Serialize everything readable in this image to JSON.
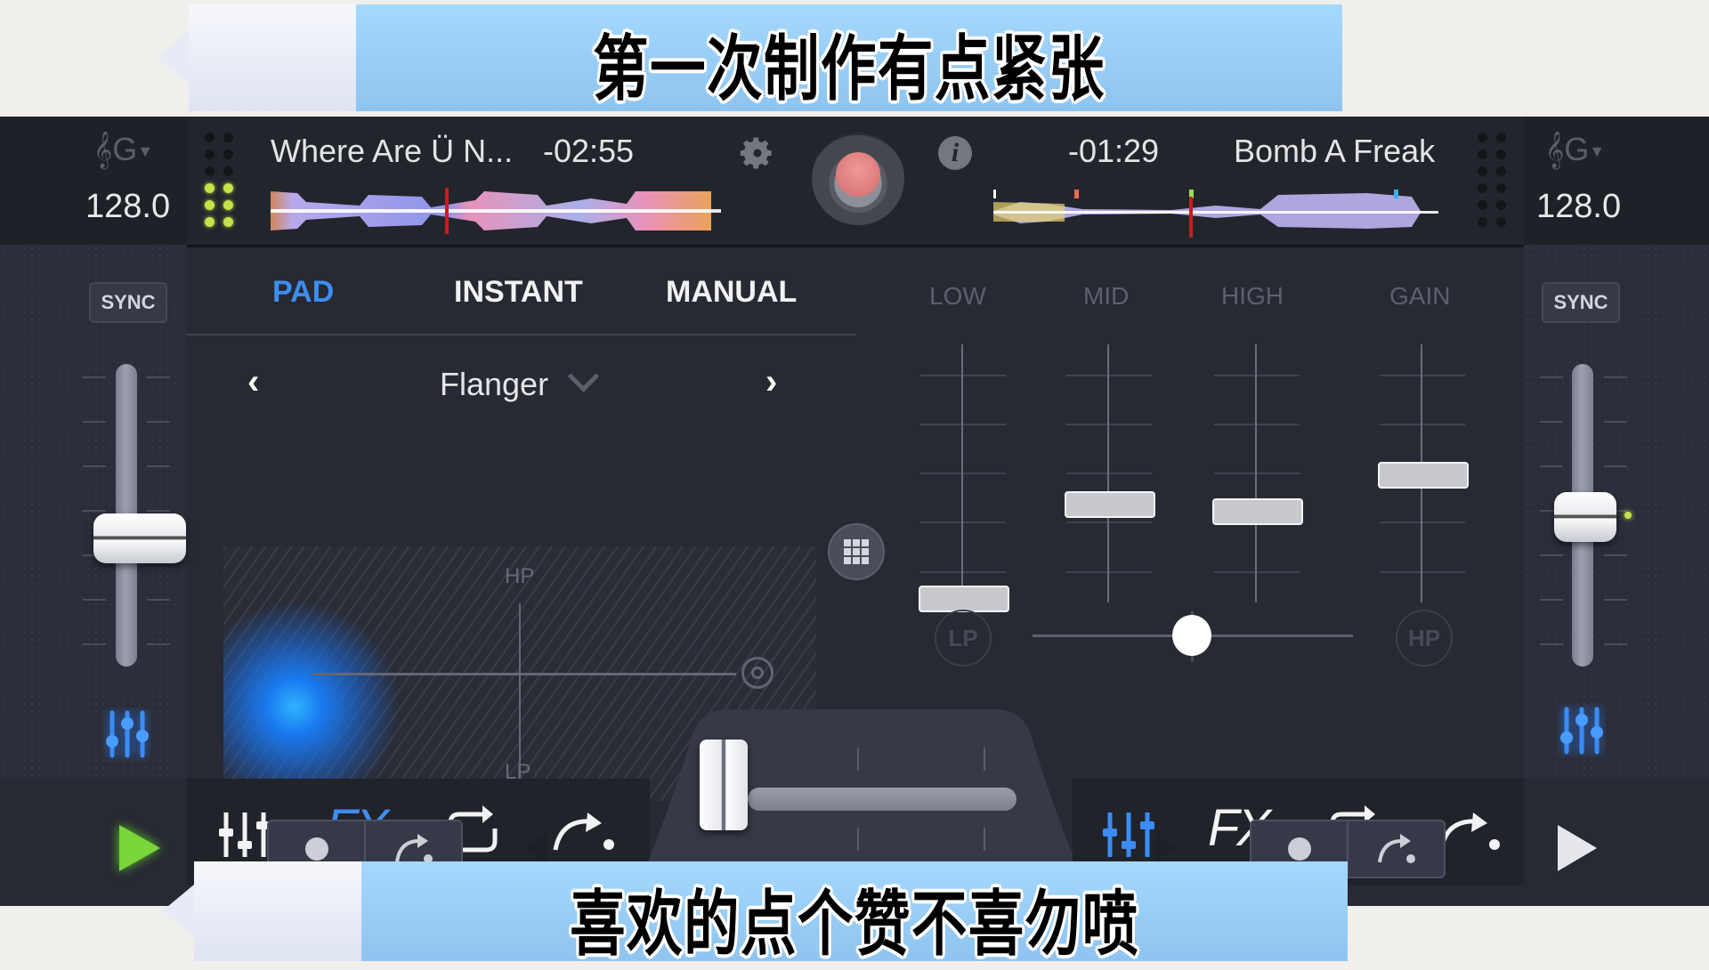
{
  "captions": {
    "top": "第一次制作有点紧张",
    "bottom": "喜欢的点个赞不喜勿喷"
  },
  "deck_left": {
    "key": "G",
    "key_icon": "treble-clef-icon",
    "bpm": "128.0",
    "track_title": "Where Are Ü N...",
    "time_remaining": "-02:55",
    "sync_label": "SYNC",
    "pitch_fader_position": 0.55,
    "play_color": "#7ad63a"
  },
  "deck_right": {
    "key": "G",
    "key_icon": "treble-clef-icon",
    "bpm": "128.0",
    "track_title": "Bomb A Freak",
    "time_remaining": "-01:29",
    "sync_label": "SYNC",
    "pitch_fader_position": 0.55
  },
  "header_center": {
    "settings_icon": "gear-icon",
    "record_icon": "record-button",
    "info_icon": "info-icon"
  },
  "fx_panel": {
    "tabs": [
      {
        "label": "PAD",
        "active": true
      },
      {
        "label": "INSTANT",
        "active": false
      },
      {
        "label": "MANUAL",
        "active": false
      }
    ],
    "effect_name": "Flanger",
    "pad_top_label": "HP",
    "pad_bottom_label": "LP",
    "accent": "#3d8ef0"
  },
  "eq_panel": {
    "bands": [
      {
        "label": "LOW",
        "value": 0.1
      },
      {
        "label": "MID",
        "value": 0.42
      },
      {
        "label": "HIGH",
        "value": 0.38
      },
      {
        "label": "GAIN",
        "value": 0.54
      }
    ],
    "lp_label": "LP",
    "hp_label": "HP",
    "filter_position": 0.5
  },
  "toolbar_left": [
    "mixer-icon",
    "FX",
    "loop-icon",
    "sampler-icon"
  ],
  "toolbar_right": [
    "mixer-icon",
    "FX",
    "loop-icon",
    "sampler-icon"
  ],
  "toolbar": {
    "fx_label": "FX"
  },
  "crossfader_position": 0.0
}
